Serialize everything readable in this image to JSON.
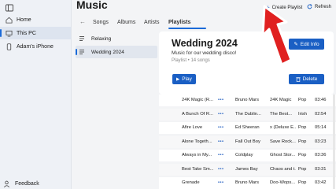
{
  "sidebar": {
    "items": [
      {
        "label": "Home",
        "icon": "home-icon"
      },
      {
        "label": "This PC",
        "icon": "pc-icon"
      },
      {
        "label": "Adam's iPhone",
        "icon": "phone-icon"
      }
    ],
    "feedback_label": "Feedback"
  },
  "header": {
    "title": "Music",
    "create_playlist_label": "Create Playlist",
    "refresh_label": "Refresh",
    "tabs": [
      "Songs",
      "Albums",
      "Artists",
      "Playlists"
    ]
  },
  "playlists": [
    {
      "label": "Relaxing"
    },
    {
      "label": "Wedding 2024"
    }
  ],
  "detail": {
    "title": "Wedding 2024",
    "subtitle": "Music for our wedding disco!",
    "meta": "Playlist • 14 songs",
    "edit_label": "Edit Info",
    "play_label": "Play",
    "delete_label": "Delete"
  },
  "songs": [
    {
      "title": "24K Magic (R...",
      "more": "•••",
      "artist": "Bruno Mars",
      "album": "24K Magic",
      "genre": "Pop",
      "duration": "03:46"
    },
    {
      "title": "A Bunch Of R...",
      "more": "•••",
      "artist": "The Dublin...",
      "album": "The Best...",
      "genre": "Irish",
      "duration": "02:54"
    },
    {
      "title": "Afire Love",
      "more": "•••",
      "artist": "Ed Sheeran",
      "album": "x (Deluxe E...",
      "genre": "Pop",
      "duration": "05:14"
    },
    {
      "title": "Alone Togeth...",
      "more": "•••",
      "artist": "Fall Out Boy",
      "album": "Save Rock...",
      "genre": "Pop",
      "duration": "03:23"
    },
    {
      "title": "Always in My...",
      "more": "•••",
      "artist": "Coldplay",
      "album": "Ghost Stor...",
      "genre": "Pop",
      "duration": "03:36"
    },
    {
      "title": "Best Take Sm...",
      "more": "•••",
      "artist": "James Bay",
      "album": "Chaos and t...",
      "genre": "Pop",
      "duration": "03:31"
    },
    {
      "title": "Grenade",
      "more": "•••",
      "artist": "Bruno Mars",
      "album": "Doo-Wops...",
      "genre": "Pop",
      "duration": "03:42"
    }
  ],
  "colors": {
    "accent": "#1a5fc4",
    "arrow": "#e02020"
  }
}
